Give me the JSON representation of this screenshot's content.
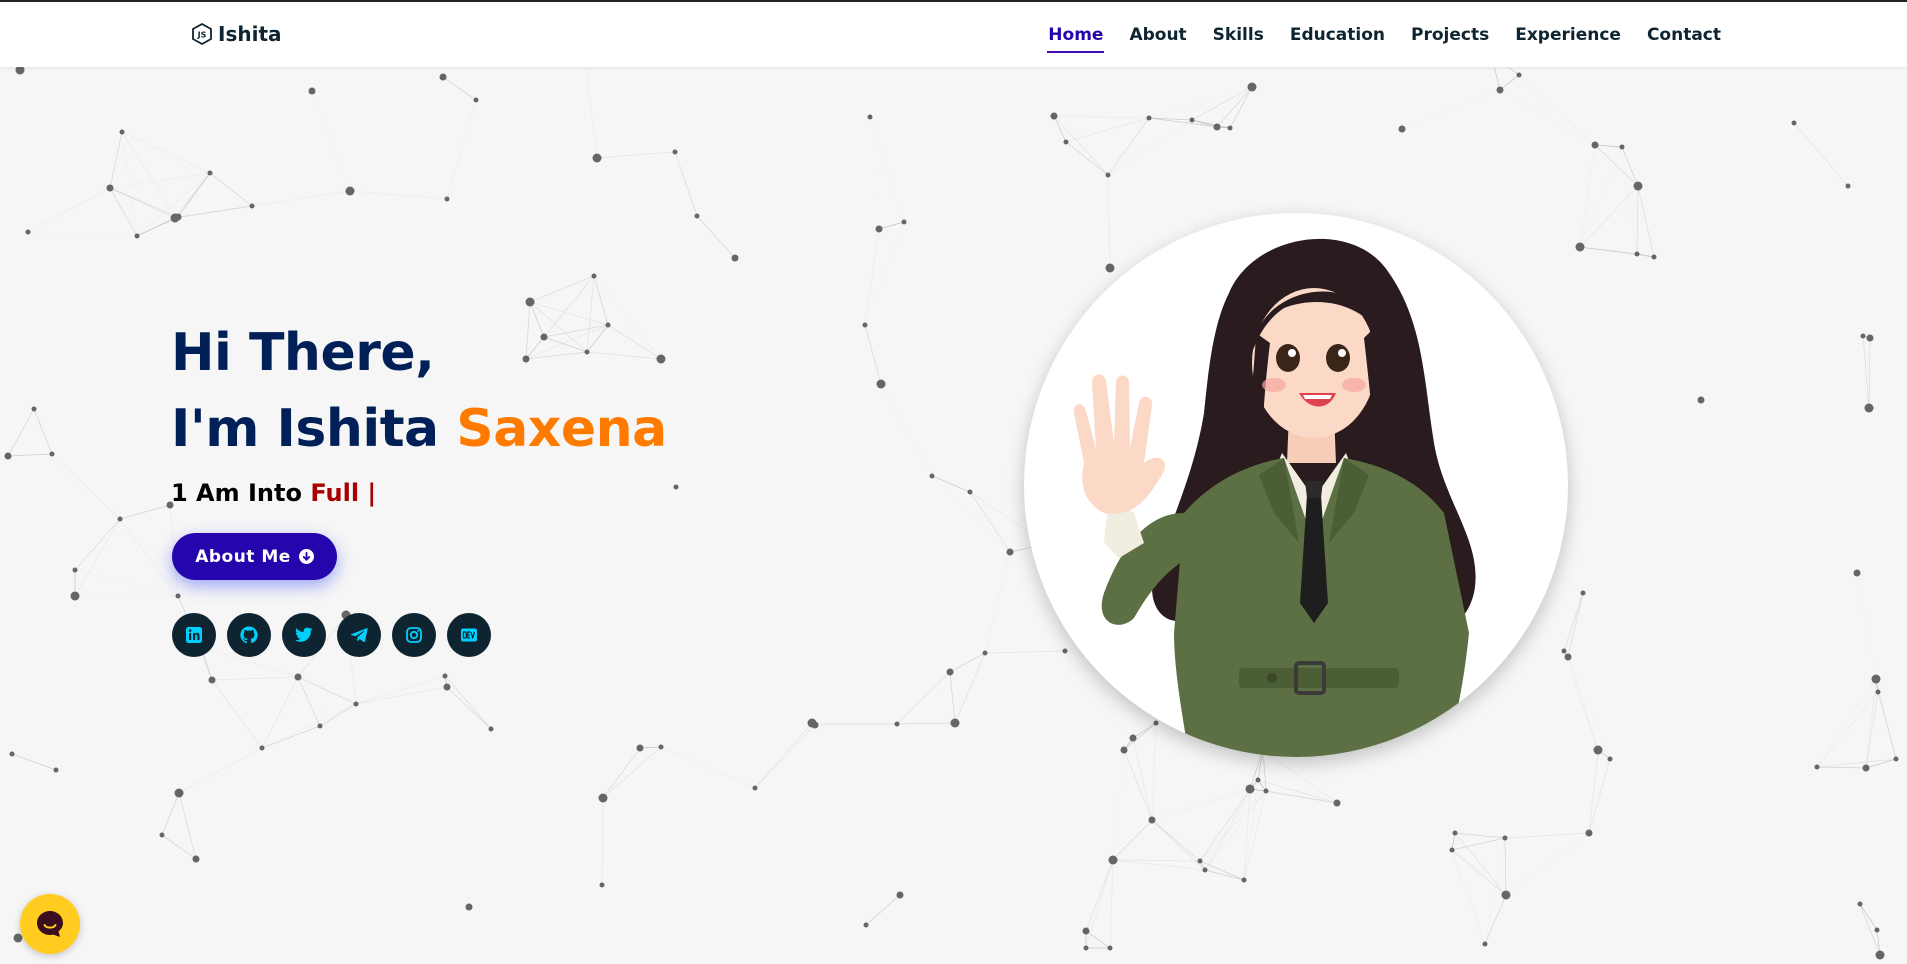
{
  "brand": {
    "name": "Ishita",
    "icon": "nodejs-hex-icon"
  },
  "nav": {
    "items": [
      {
        "label": "Home",
        "active": true
      },
      {
        "label": "About",
        "active": false
      },
      {
        "label": "Skills",
        "active": false
      },
      {
        "label": "Education",
        "active": false
      },
      {
        "label": "Projects",
        "active": false
      },
      {
        "label": "Experience",
        "active": false
      },
      {
        "label": "Contact",
        "active": false
      }
    ]
  },
  "hero": {
    "greeting": "Hi There,",
    "intro_prefix": "I'm Ishita ",
    "intro_accent": "Saxena",
    "typing_prefix": "1 Am Into ",
    "typing_value": "Full |",
    "button_label": "About Me",
    "button_icon": "arrow-down-circle-icon"
  },
  "socials": [
    {
      "name": "linkedin",
      "icon": "linkedin-icon"
    },
    {
      "name": "github",
      "icon": "github-icon"
    },
    {
      "name": "twitter",
      "icon": "twitter-icon"
    },
    {
      "name": "telegram",
      "icon": "telegram-icon"
    },
    {
      "name": "instagram",
      "icon": "instagram-icon"
    },
    {
      "name": "dev",
      "icon": "dev-icon"
    }
  ],
  "avatar": {
    "description_icon": "waving-girl-avatar"
  },
  "chat": {
    "icon": "chat-bubble-icon"
  },
  "colors": {
    "nav_text": "#0e2431",
    "nav_active": "#2506ad",
    "heading": "#002057",
    "accent_orange": "#ff7b00",
    "typed_red": "#a80000",
    "button_bg": "#2506ad",
    "social_bg": "#0e2431",
    "social_icon": "#00d0ff",
    "chat_bg": "#ffcc1f",
    "background": "#f6f6f6"
  }
}
